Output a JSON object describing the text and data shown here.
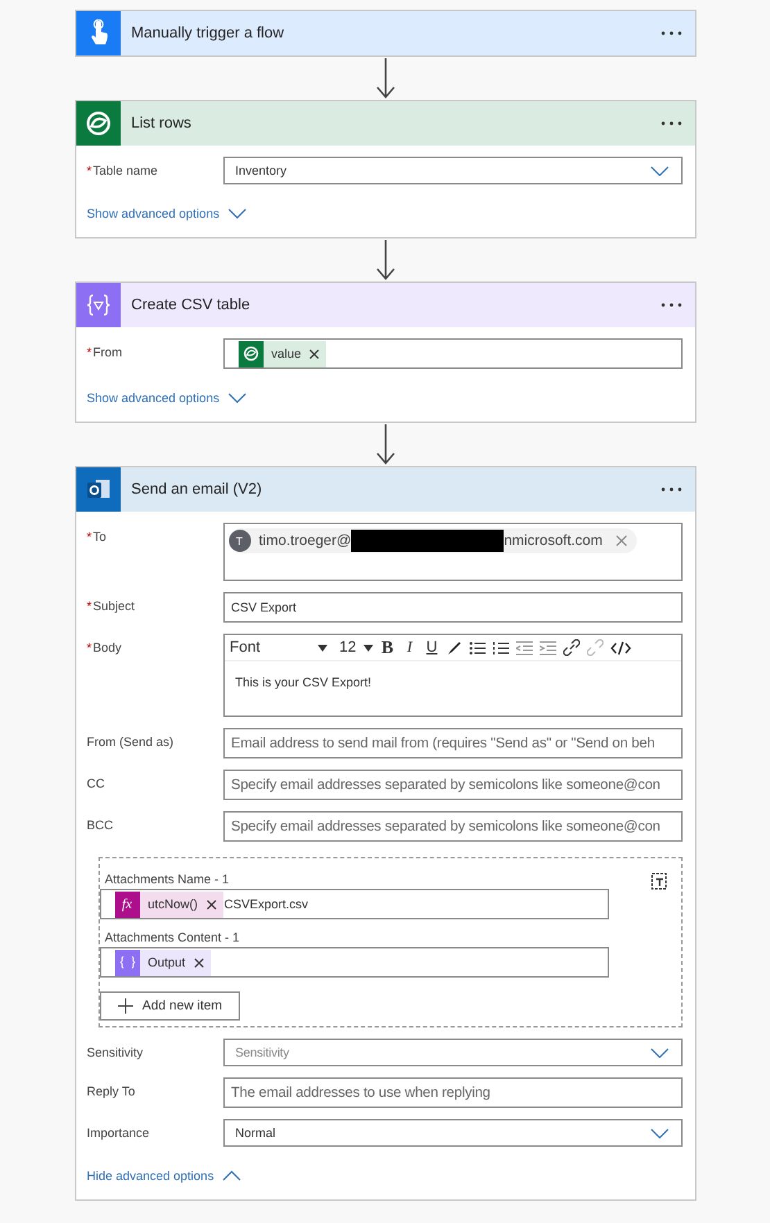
{
  "required_symbol": "*",
  "steps": [
    {
      "kind": "trigger",
      "title": "Manually trigger a flow",
      "color": "#1a7cf5"
    },
    {
      "kind": "dataverse",
      "title": "List rows",
      "color": "#0b7a3e",
      "fields": [
        {
          "kind": "dropdown",
          "label": "Table name",
          "required": true,
          "value": "Inventory"
        }
      ],
      "advanced": {
        "label": "Show advanced options",
        "expanded": false
      }
    },
    {
      "kind": "csv",
      "title": "Create CSV table",
      "color": "#8c6ff2",
      "fields": [
        {
          "kind": "tokens",
          "label": "From",
          "required": true,
          "tokens": [
            {
              "kind": "dataverse",
              "text": "value"
            }
          ]
        }
      ],
      "advanced": {
        "label": "Show advanced options",
        "expanded": false
      }
    },
    {
      "kind": "outlook",
      "title": "Send an email (V2)",
      "color": "#0f6cbd",
      "fields": [
        {
          "kind": "recipients",
          "label": "To",
          "required": true,
          "recipients": [
            {
              "initial": "T",
              "before": "timo.troeger@",
              "after": "nmicrosoft.com",
              "redacted": true
            }
          ]
        },
        {
          "kind": "text",
          "label": "Subject",
          "required": true,
          "value": "CSV Export"
        },
        {
          "kind": "richtext",
          "label": "Body",
          "required": true,
          "font": "Font",
          "size": "12",
          "format_buttons": [
            "B",
            "I",
            "U"
          ],
          "value": "This is your CSV Export!"
        },
        {
          "kind": "text",
          "label": "From (Send as)",
          "required": false,
          "placeholder": "Email address to send mail from (requires \"Send as\" or \"Send on beh"
        },
        {
          "kind": "text",
          "label": "CC",
          "required": false,
          "placeholder": "Specify email addresses separated by semicolons like someone@con"
        },
        {
          "kind": "text",
          "label": "BCC",
          "required": false,
          "placeholder": "Specify email addresses separated by semicolons like someone@con"
        },
        {
          "kind": "array",
          "add_label": "Add new item",
          "items": [
            {
              "label": "Attachments Name - 1",
              "tokens": [
                {
                  "kind": "expression",
                  "symbol": "fx",
                  "text": "utcNow()"
                }
              ],
              "value": "CSVExport.csv"
            },
            {
              "label": "Attachments Content - 1",
              "tokens": [
                {
                  "kind": "csv",
                  "text": "Output"
                }
              ]
            }
          ]
        },
        {
          "kind": "dropdown",
          "label": "Sensitivity",
          "required": false,
          "placeholder": "Sensitivity"
        },
        {
          "kind": "text",
          "label": "Reply To",
          "required": false,
          "placeholder": "The email addresses to use when replying"
        },
        {
          "kind": "dropdown",
          "label": "Importance",
          "required": false,
          "value": "Normal"
        }
      ],
      "advanced": {
        "label": "Hide advanced options",
        "expanded": true
      }
    }
  ]
}
